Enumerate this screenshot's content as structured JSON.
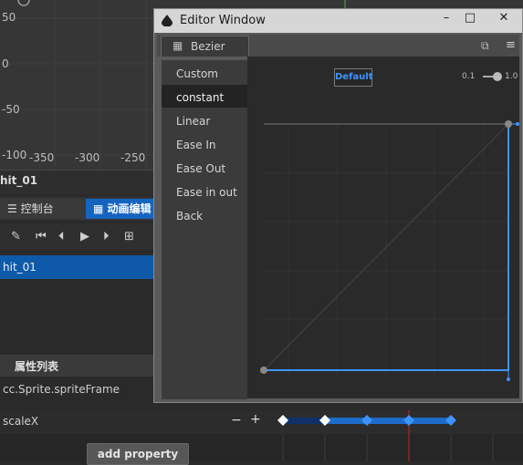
{
  "scene": {
    "y_ticks": [
      "50",
      "0",
      "-50",
      "-100"
    ],
    "x_ticks": [
      "-350",
      "-300",
      "-250"
    ]
  },
  "clip_title": "hit_01",
  "tabs": [
    {
      "icon": "console-icon",
      "label": "控制台"
    },
    {
      "icon": "film-icon",
      "label": "动画编辑"
    }
  ],
  "toolbar": {
    "buttons": [
      "edit-icon",
      "first-frame-icon",
      "prev-frame-icon",
      "play-icon",
      "next-frame-icon",
      "add-event-icon"
    ]
  },
  "clip_list": {
    "selected": "hit_01"
  },
  "properties": {
    "header": "属性列表",
    "items": [
      "cc.Sprite.spriteFrame",
      "scaleX"
    ],
    "minus": "−",
    "plus": "+",
    "add_property": "add property"
  },
  "editor_window": {
    "title": "Editor Window",
    "tab": "Bezier",
    "menu_items": [
      "Custom",
      "constant",
      "Linear",
      "Ease In",
      "Ease Out",
      "Ease in out",
      "Back"
    ],
    "selected_item": "constant",
    "default_label": "Default",
    "zoom": {
      "min": "0.1",
      "max": "1.0"
    },
    "window_buttons": {
      "minimize": "–",
      "maximize": "□",
      "close": "✕"
    }
  },
  "colors": {
    "accent": "#3d94ff",
    "selection": "#0f5aa8",
    "timeline_marker": "#cc2222"
  }
}
